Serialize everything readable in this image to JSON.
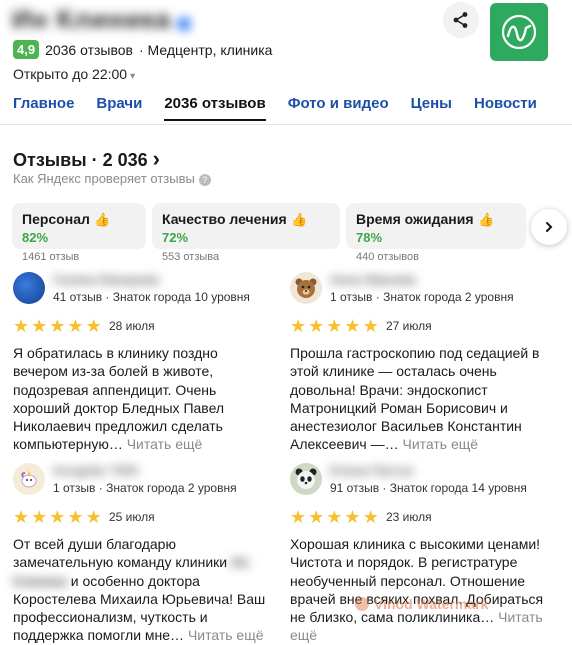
{
  "header": {
    "title": "Ин Клиника",
    "rating": "4,9",
    "reviews_count_text": "2036 отзывов",
    "category": "· Медцентр, клиника",
    "open_status": "Открыто до 22:00",
    "caret": "▾"
  },
  "tabs": [
    {
      "label": "Главное"
    },
    {
      "label": "Врачи"
    },
    {
      "label": "2036 отзывов"
    },
    {
      "label": "Фото и видео"
    },
    {
      "label": "Цены"
    },
    {
      "label": "Новости"
    }
  ],
  "section": {
    "title": "Отзывы · 2 036 ",
    "chevron": "›",
    "subtitle": "Как Яндекс проверяет отзывы",
    "help_glyph": "?"
  },
  "aspects": [
    {
      "name": "Персонал",
      "percent": "82%",
      "count": "1461 отзыв"
    },
    {
      "name": "Качество лечения",
      "percent": "72%",
      "count": "553 отзыва"
    },
    {
      "name": "Время ожидания",
      "percent": "78%",
      "count": "440 отзывов"
    }
  ],
  "reviews": [
    {
      "author": "Галина Макарова",
      "meta": "41 отзыв · Знаток города 10 уровня",
      "date": "28 июля",
      "text": "Я обратилась в клинику поздно вечером из-за болей в животе, подозревая аппендицит. Очень хороший доктор Бледных Павел Николаевич предложил сделать компьютерную…",
      "more": "Читать ещё"
    },
    {
      "author": "Анна Иванова",
      "meta": "1 отзыв · Знаток города 2 уровня",
      "date": "27 июля",
      "text": "Прошла гастроскопию под седацией в этой клинике — осталась очень довольна! Врачи: эндоскопист Матроницкий Роман Борисович и анестезиолог Васильев Константин Алексеевич —…",
      "more": "Читать ещё"
    },
    {
      "author": "Incognito 7945",
      "meta": "1 отзыв · Знаток города 2 уровня",
      "date": "25 июля",
      "text_a": "От всей души благодарю замечательную команду клиники",
      "text_b": " и особенно доктора Коростелева Михаила Юрьевича! Ваш профессионализм, чуткость и поддержка помогли мне…",
      "blurred_name": "Ин Клиника",
      "more": "Читать ещё"
    },
    {
      "author": "Елена Пастух",
      "meta": "91 отзыв · Знаток города 14 уровня",
      "date": "23 июля",
      "text": "Хорошая клиника с высокими ценами! Чистота и порядок. В регистратуре необученный персонал. Отношение врачей вне всяких похвал. Добираться не близко, сама поликлиника…",
      "more": "Читать ещё"
    }
  ],
  "watermark": "Vinod Watermark",
  "colors": {
    "accent": "#1e4fa8",
    "rating_green": "#4cb550",
    "star": "#f6c02e",
    "positive": "#3aa64a"
  }
}
